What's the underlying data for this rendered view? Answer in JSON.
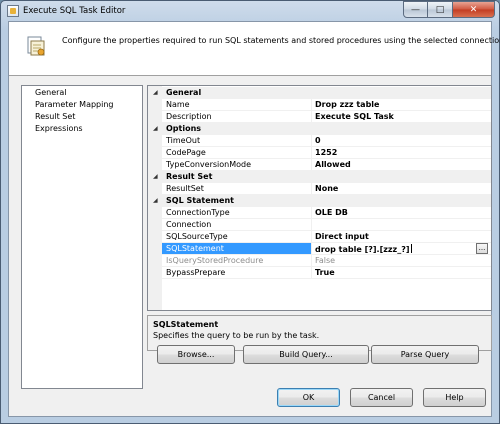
{
  "window": {
    "title": "Execute SQL Task Editor",
    "buttons": {
      "minimize": "—",
      "maximize": "□",
      "close": "✕"
    }
  },
  "header": {
    "description": "Configure the properties required to run SQL statements and stored procedures using the selected connection."
  },
  "nav": {
    "items": [
      {
        "label": "General",
        "selected": true
      },
      {
        "label": "Parameter Mapping",
        "selected": false
      },
      {
        "label": "Result Set",
        "selected": false
      },
      {
        "label": "Expressions",
        "selected": false
      }
    ]
  },
  "grid": {
    "rows": [
      {
        "type": "category",
        "name": "General"
      },
      {
        "type": "prop",
        "name": "Name",
        "value": "Drop zzz table"
      },
      {
        "type": "prop",
        "name": "Description",
        "value": "Execute SQL Task"
      },
      {
        "type": "category",
        "name": "Options"
      },
      {
        "type": "prop",
        "name": "TimeOut",
        "value": "0"
      },
      {
        "type": "prop",
        "name": "CodePage",
        "value": "1252"
      },
      {
        "type": "prop",
        "name": "TypeConversionMode",
        "value": "Allowed"
      },
      {
        "type": "category",
        "name": "Result Set"
      },
      {
        "type": "prop",
        "name": "ResultSet",
        "value": "None"
      },
      {
        "type": "category",
        "name": "SQL Statement"
      },
      {
        "type": "prop",
        "name": "ConnectionType",
        "value": "OLE DB"
      },
      {
        "type": "prop",
        "name": "Connection",
        "value": ""
      },
      {
        "type": "prop",
        "name": "SQLSourceType",
        "value": "Direct input"
      },
      {
        "type": "prop",
        "name": "SQLStatement",
        "value": "drop table [?].[zzz_?]",
        "selected": true,
        "ellipsis": "..."
      },
      {
        "type": "prop",
        "name": "IsQueryStoredProcedure",
        "value": "False",
        "disabled": true
      },
      {
        "type": "prop",
        "name": "BypassPrepare",
        "value": "True"
      }
    ]
  },
  "description_pane": {
    "title": "SQLStatement",
    "text": "Specifies the query to be run by the task."
  },
  "actions": {
    "browse": "Browse...",
    "build_query": "Build Query...",
    "parse_query": "Parse Query"
  },
  "footer": {
    "ok": "OK",
    "cancel": "Cancel",
    "help": "Help"
  },
  "icons": {
    "category_toggle": "collapse-triangle-icon"
  },
  "colors": {
    "selection": "#3399ff",
    "category_bg": "#f0f0f0"
  }
}
